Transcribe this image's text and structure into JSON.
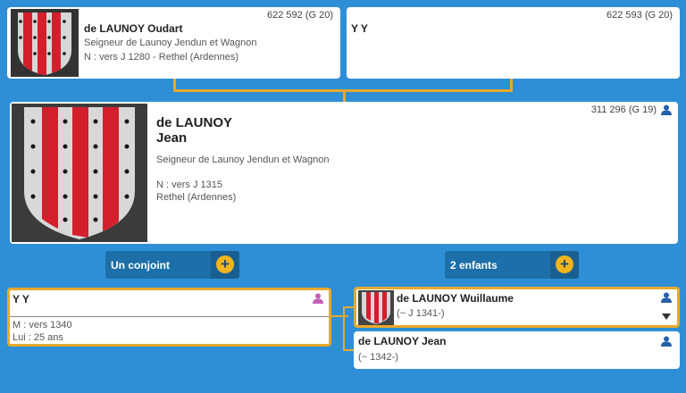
{
  "father": {
    "sosa": "622 592 (G 20)",
    "name": "de LAUNOY Oudart",
    "title": "Seigneur de Launoy Jendun et Wagnon",
    "birth": "N : vers J 1280 - Rethel (Ardennes)"
  },
  "mother": {
    "sosa": "622 593 (G 20)",
    "name": "Y Y"
  },
  "main": {
    "sosa": "311 296 (G 19)",
    "surname": "de LAUNOY",
    "given": "Jean",
    "title": "Seigneur de Launoy Jendun et Wagnon",
    "birth": "N : vers J 1315",
    "place": "Rethel (Ardennes)"
  },
  "buttons": {
    "spouse_label": "Un conjoint",
    "children_label": "2 enfants"
  },
  "spouse": {
    "name": "Y Y",
    "marriage": "M : vers 1340",
    "age": "Lui : 25 ans"
  },
  "children": [
    {
      "name": "de LAUNOY Wuillaume",
      "dates": "(~ J 1341-)"
    },
    {
      "name": "de LAUNOY Jean",
      "dates": "(~ 1342-)"
    }
  ],
  "colors": {
    "background": "#2f8fd6",
    "accent": "#e8a92c",
    "button": "#1c6fa8",
    "shield_red": "#d31f2c",
    "male_icon": "#2360a8",
    "female_icon": "#c45fb8"
  },
  "icons": {
    "plus": "+",
    "male": "male-person-icon",
    "female": "female-person-icon",
    "expand": "triangle-down-icon"
  }
}
